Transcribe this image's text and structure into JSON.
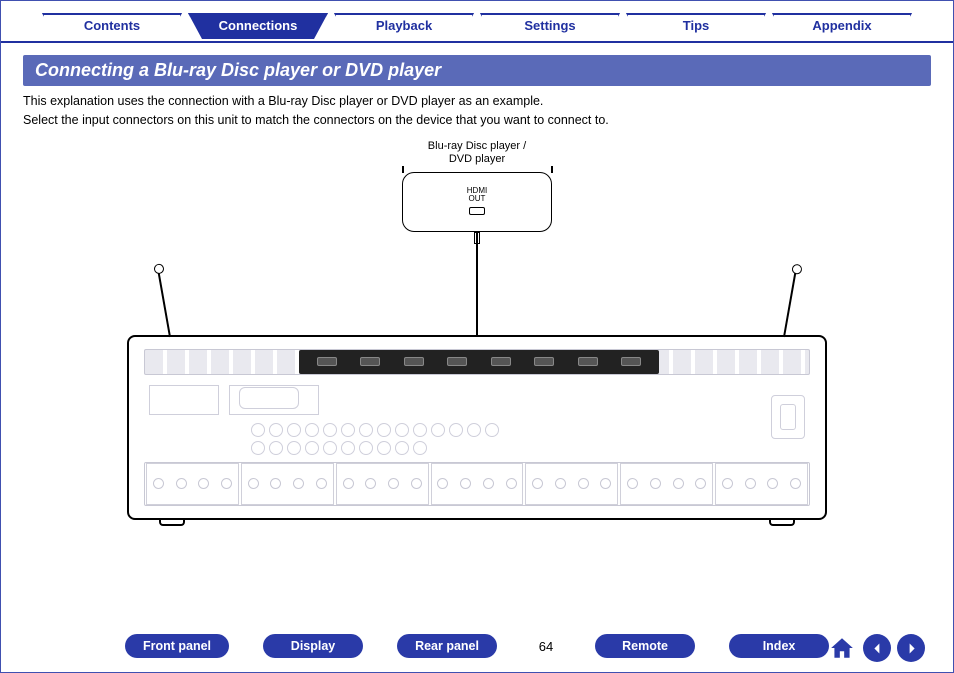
{
  "tabs": [
    {
      "label": "Contents",
      "active": false
    },
    {
      "label": "Connections",
      "active": true
    },
    {
      "label": "Playback",
      "active": false
    },
    {
      "label": "Settings",
      "active": false
    },
    {
      "label": "Tips",
      "active": false
    },
    {
      "label": "Appendix",
      "active": false
    }
  ],
  "heading": "Connecting a Blu-ray Disc player or DVD player",
  "intro_line1": "This explanation uses the connection with a Blu-ray Disc player or DVD player as an example.",
  "intro_line2": "Select the input connectors on this unit to match the connectors on the device that you want to connect to.",
  "diagram": {
    "source_label_line1": "Blu-ray Disc player /",
    "source_label_line2": "DVD player",
    "source_port_label_line1": "HDMI",
    "source_port_label_line2": "OUT"
  },
  "page_number": "64",
  "bottom_nav": {
    "front_panel": "Front panel",
    "display": "Display",
    "rear_panel": "Rear panel",
    "remote": "Remote",
    "index": "Index"
  }
}
